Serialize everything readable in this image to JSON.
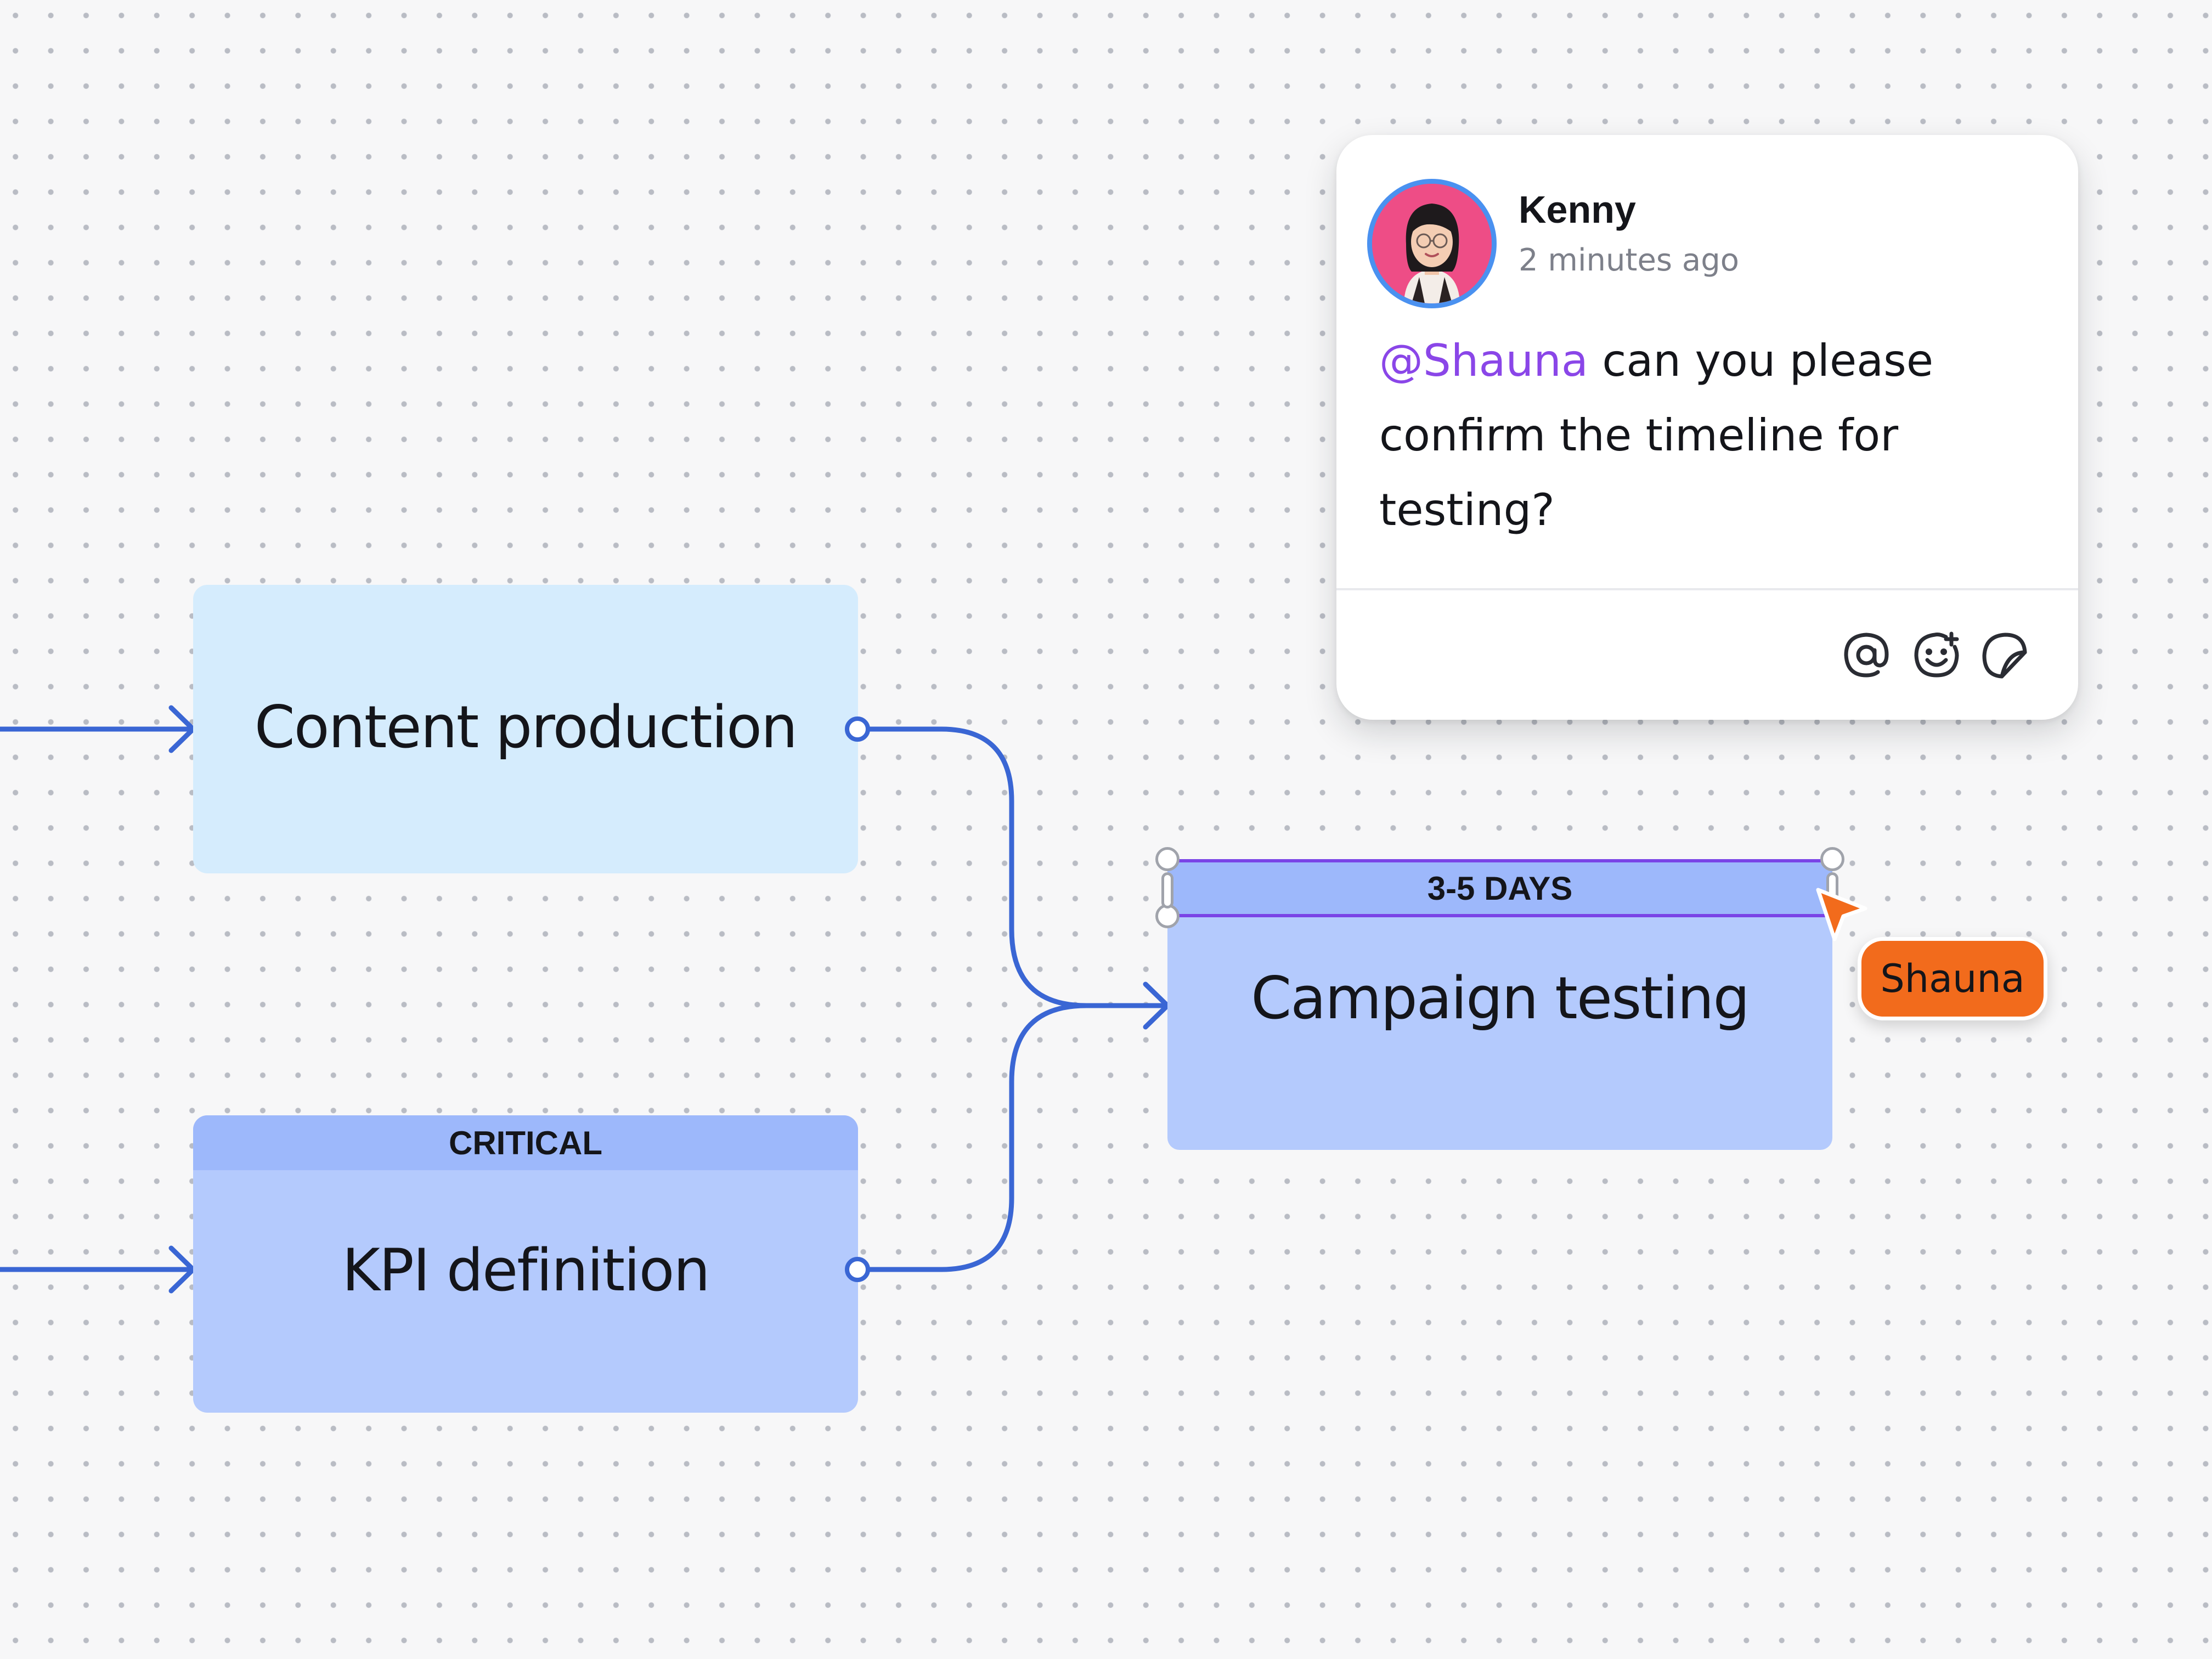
{
  "nodes": {
    "content": {
      "label": "Content production"
    },
    "kpi": {
      "label": "KPI definition",
      "header": "CRITICAL"
    },
    "campaign": {
      "label": "Campaign testing",
      "header": "3-5 DAYS"
    }
  },
  "comment": {
    "author": "Kenny",
    "time": "2 minutes ago",
    "mention": "@Shauna",
    "body": " can you please confirm the timeline for testing?",
    "tools": [
      "at-mention-icon",
      "emoji-add-icon",
      "sticker-icon"
    ]
  },
  "cursor": {
    "name": "Shauna",
    "color": "#f26b1c"
  },
  "colors": {
    "connector": "#3a66d4",
    "selection": "#7a44e6",
    "mention": "#8a46e8",
    "avatar_ring": "#4a91f0"
  }
}
